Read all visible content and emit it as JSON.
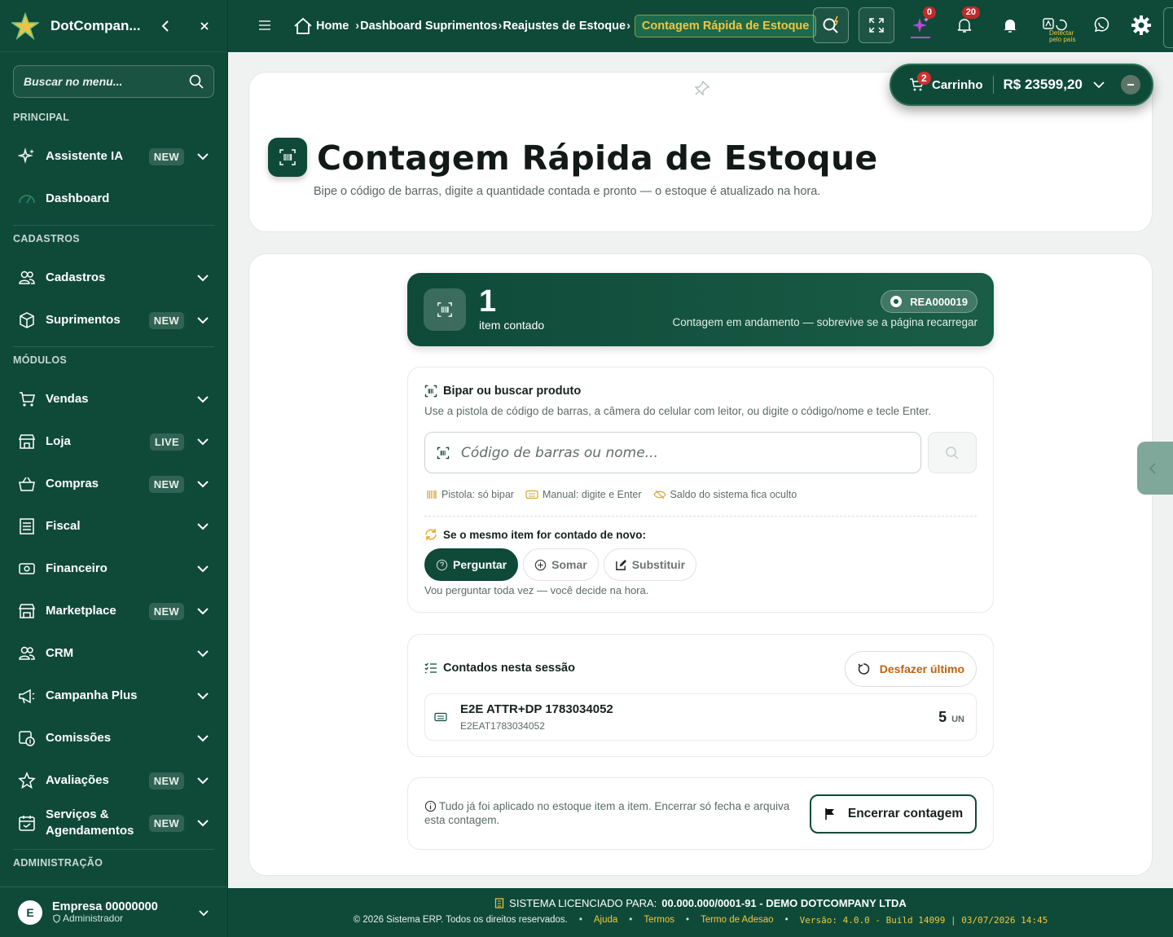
{
  "brand": {
    "name": "DotCompan..."
  },
  "sidebar": {
    "search_placeholder": "Buscar no menu...",
    "sections": {
      "principal": "PRINCIPAL",
      "cadastros": "CADASTROS",
      "modulos": "MÓDULOS",
      "administracao": "ADMINISTRAÇÃO"
    },
    "items": [
      {
        "label": "Assistente IA",
        "badge": "NEW",
        "icon": "sparkles-icon"
      },
      {
        "label": "Dashboard",
        "badge": "",
        "icon": "gauge-icon"
      },
      {
        "label": "Cadastros",
        "badge": "",
        "icon": "users-icon"
      },
      {
        "label": "Suprimentos",
        "badge": "NEW",
        "icon": "box-icon"
      },
      {
        "label": "Vendas",
        "badge": "",
        "icon": "cart-icon"
      },
      {
        "label": "Loja",
        "badge": "LIVE",
        "icon": "store-icon"
      },
      {
        "label": "Compras",
        "badge": "NEW",
        "icon": "basket-icon"
      },
      {
        "label": "Fiscal",
        "badge": "",
        "icon": "receipt-icon"
      },
      {
        "label": "Financeiro",
        "badge": "",
        "icon": "cash-icon"
      },
      {
        "label": "Marketplace",
        "badge": "NEW",
        "icon": "shop-icon"
      },
      {
        "label": "CRM",
        "badge": "",
        "icon": "people-icon"
      },
      {
        "label": "Campanha Plus",
        "badge": "",
        "icon": "megaphone-icon"
      },
      {
        "label": "Comissões",
        "badge": "",
        "icon": "commission-icon"
      },
      {
        "label": "Avaliações",
        "badge": "NEW",
        "icon": "star-icon"
      },
      {
        "label": "Serviços & Agendamentos",
        "badge": "NEW",
        "icon": "calendar-icon"
      }
    ],
    "user": {
      "initial": "E",
      "name": "Empresa 00000000",
      "role": "Administrador"
    }
  },
  "topbar": {
    "breadcrumbs": [
      "Home",
      "Dashboard Suprimentos",
      "Reajustes de Estoque",
      "Contagem Rápida de Estoque"
    ],
    "ai_count": "0",
    "notif_count": "20",
    "detect_label": "Detectar pelo país"
  },
  "cart": {
    "count": "2",
    "label": "Carrinho",
    "total": "R$ 23599,20"
  },
  "page": {
    "title": "Contagem Rápida de Estoque",
    "subtitle": "Bipe o código de barras, digite a quantidade contada e pronto — o estoque é atualizado na hora."
  },
  "status": {
    "count": "1",
    "count_label": "item contado",
    "code": "REA000019",
    "note": "Contagem em andamento — sobrevive se a página recarregar"
  },
  "scan": {
    "title": "Bipar ou buscar produto",
    "subtitle": "Use a pistola de código de barras, a câmera do celular com leitor, ou digite o código/nome e tecle Enter.",
    "placeholder": "Código de barras ou nome...",
    "hints": [
      "Pistola: só bipar",
      "Manual: digite e Enter",
      "Saldo do sistema fica oculto"
    ],
    "repeat_title": "Se o mesmo item for contado de novo:",
    "options": [
      "Perguntar",
      "Somar",
      "Substituir"
    ],
    "selected_option": "Perguntar",
    "option_help": "Vou perguntar toda vez — você decide na hora."
  },
  "session": {
    "title": "Contados nesta sessão",
    "undo_label": "Desfazer último",
    "items": [
      {
        "name": "E2E ATTR+DP 1783034052",
        "code": "E2EAT1783034052",
        "qty": "5",
        "unit": "UN"
      }
    ]
  },
  "finish": {
    "note": "Tudo já foi aplicado no estoque item a item. Encerrar só fecha e arquiva esta contagem.",
    "button": "Encerrar contagem"
  },
  "footer": {
    "license_prefix": "SISTEMA LICENCIADO PARA:",
    "license_value": "00.000.000/0001-91 - DEMO DOTCOMPANY LTDA",
    "copyright": "© 2026 Sistema ERP. Todos os direitos reservados.",
    "links": [
      "Ajuda",
      "Termos",
      "Termo de Adesao"
    ],
    "version": "Versão: 4.0.0 - Build 14099 | 03/07/2026 14:45"
  },
  "colors": {
    "primary": "#0f4a39",
    "accent": "#f3c53e",
    "warning": "#c2620c",
    "badge": "#c62828"
  }
}
